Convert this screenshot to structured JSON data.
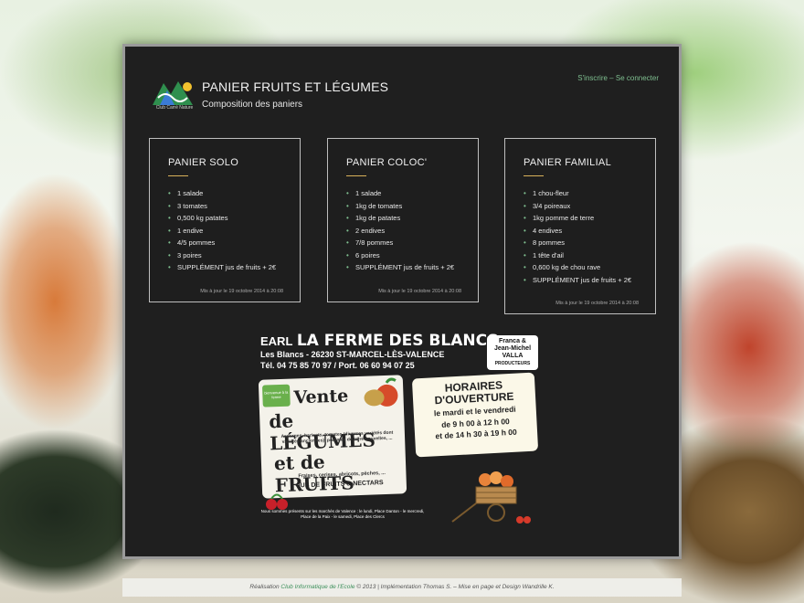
{
  "header": {
    "title": "PANIER FRUITS ET LÉGUMES",
    "subtitle": "Composition des paniers",
    "logo_caption": "Club Carré Nature",
    "auth": {
      "signup": "S'inscrire",
      "separator": " – ",
      "login": "Se connecter"
    }
  },
  "cards": [
    {
      "title": "PANIER SOLO",
      "items": [
        "1 salade",
        "3 tomates",
        "0,500 kg patates",
        "1 endive",
        "4/5 pommes",
        "3 poires",
        "SUPPLÉMENT jus de fruits + 2€"
      ],
      "updated": "Mis à jour le 19 octobre 2014 à 20:08"
    },
    {
      "title": "PANIER COLOC'",
      "items": [
        "1 salade",
        "1kg de tomates",
        "1kg de patates",
        "2 endives",
        "7/8 pommes",
        "6 poires",
        "SUPPLÉMENT jus de fruits + 2€"
      ],
      "updated": "Mis à jour le 19 octobre 2014 à 20:08"
    },
    {
      "title": "PANIER FAMILIAL",
      "items": [
        "1 chou-fleur",
        "3/4 poireaux",
        "1kg pomme de terre",
        "4 endives",
        "8 pommes",
        "1 tête d'ail",
        "0,600 kg de chou rave",
        "SUPPLÉMENT jus de fruits + 2€"
      ],
      "updated": "Mis à jour le 19 octobre 2014 à 20:08"
    }
  ],
  "flyer": {
    "earl": "EARL",
    "name": "LA FERME DES BLANCS",
    "address": "Les Blancs - 26230 ST-MARCEL-LÈS-VALENCE",
    "phone": "Tél. 04 75 85 70 97 / Port. 06 60 94 07 25",
    "producers_line1": "Franca &",
    "producers_line2": "Jean-Michel",
    "producers_line3": "VALLA",
    "producers_line4": "PRODUCTEURS",
    "badge": "bienvenue à la ferme",
    "vente": "Vente",
    "de_legumes": "de LÉGUMES",
    "legumes_detail": "Asperges, haricots, tomates (diverses variétés dont variétés anciennes), pommes de terre nouvelles, ...",
    "et_de_fruits": "et de FRUITS",
    "fruits_detail": "Fraises, cerises, abricots, pêches, ...",
    "jus": "JUS DE FRUITS & NECTARS",
    "horaires_title": "HORAIRES D'OUVERTURE",
    "horaires_days": "le mardi et le vendredi",
    "horaires_morning": "de 9 h 00 à 12 h 00",
    "horaires_afternoon": "et de 14 h 30 à 19 h 00",
    "markets": "Nous sommes présents sur les marchés de Valence : le lundi, Place Danton - le mercredi, Place de la Paix - le samedi, Place des Clercs"
  },
  "footer": {
    "prefix": "Réalisation ",
    "club": "Club Informatique de l'Ecole",
    "rest": " © 2013 | Implémentation Thomas S. – Mise en page et Design Wandrille K."
  },
  "colors": {
    "accent": "#7fbf90",
    "rule": "#d9b15a",
    "panel": "#1f1f1f"
  }
}
